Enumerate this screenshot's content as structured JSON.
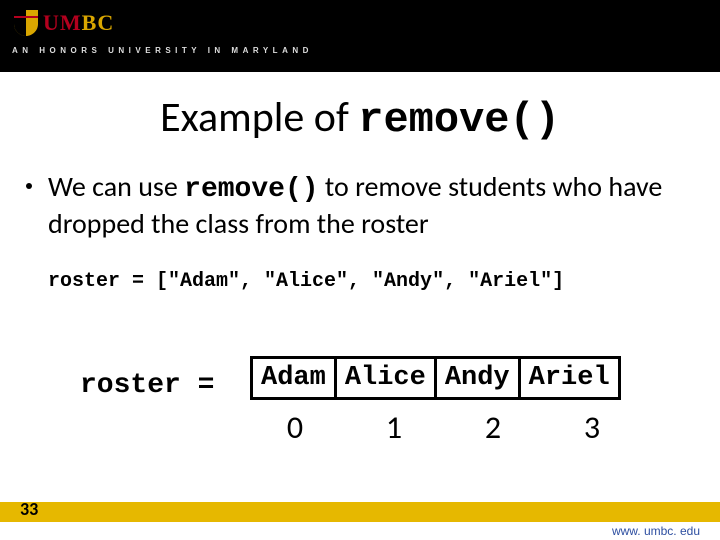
{
  "header": {
    "logo_left": "UM",
    "logo_right": "BC",
    "tagline": "AN HONORS UNIVERSITY IN MARYLAND"
  },
  "title": {
    "prefix": "Example of ",
    "code": "remove()"
  },
  "bullet": {
    "pre": "We can use ",
    "code": "remove()",
    "post": " to remove students who have dropped the class from the roster"
  },
  "code_line": "roster = [\"Adam\", \"Alice\", \"Andy\", \"Ariel\"]",
  "roster_label": "roster =",
  "roster_cells": [
    "Adam",
    "Alice",
    "Andy",
    "Ariel"
  ],
  "indices": [
    "0",
    "1",
    "2",
    "3"
  ],
  "slide_number": "33",
  "url": "www. umbc. edu"
}
